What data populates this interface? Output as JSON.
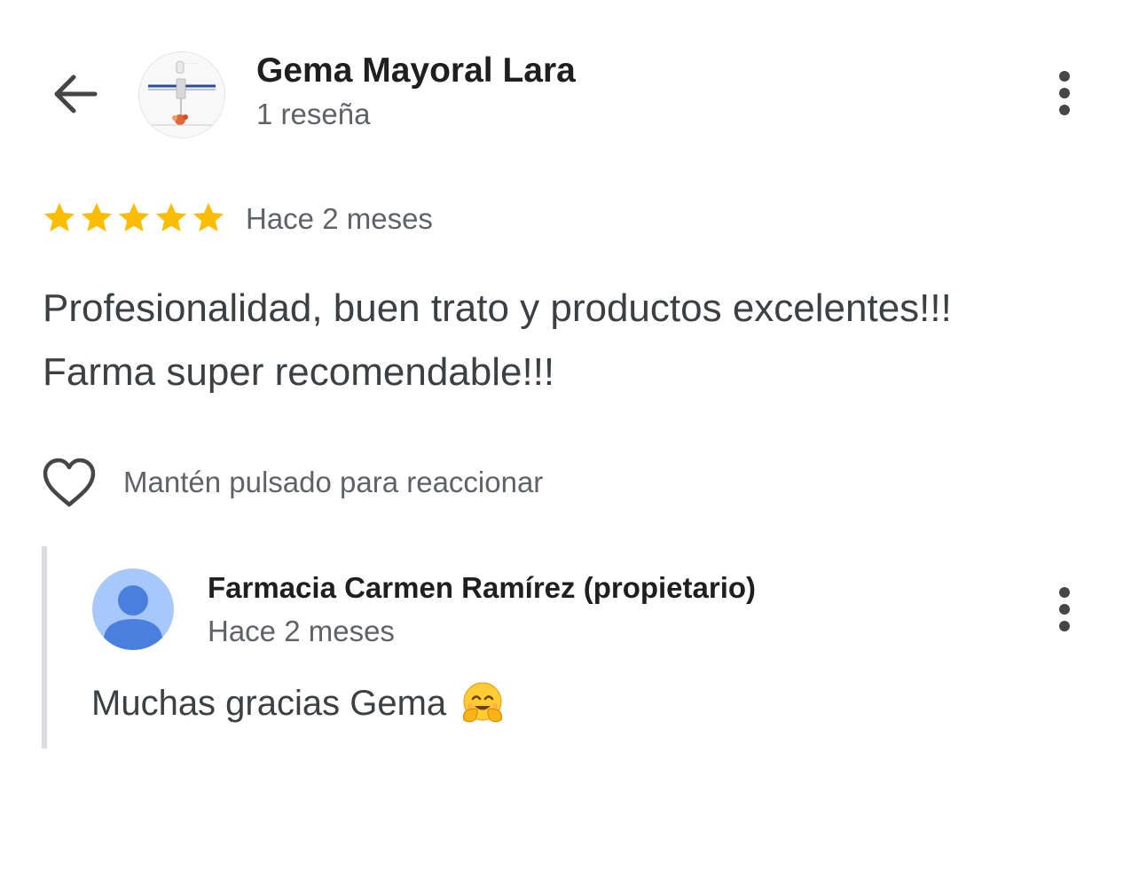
{
  "header": {
    "reviewer_name": "Gema Mayoral Lara",
    "review_count": "1 reseña"
  },
  "review": {
    "rating": 5,
    "max_rating": 5,
    "date": "Hace 2 meses",
    "text_line1": "Profesionalidad, buen trato y productos excelentes!!!",
    "text_line2": "Farma super recomendable!!!",
    "reaction_hint": "Mantén pulsado para reaccionar"
  },
  "owner_reply": {
    "name": "Farmacia Carmen Ramírez (propietario)",
    "date": "Hace 2 meses",
    "text": "Muchas gracias Gema",
    "emoji": "hugging-face"
  },
  "colors": {
    "star": "#fbbc04",
    "secondary_text": "#5f6368",
    "owner_avatar_bg": "#a8c7fa",
    "owner_avatar_fg": "#4285f4",
    "reply_bar": "#dadce0"
  },
  "icons": {
    "back": "arrow-left-icon",
    "more": "more-vert-icon",
    "reaction": "heart-outline-icon"
  }
}
